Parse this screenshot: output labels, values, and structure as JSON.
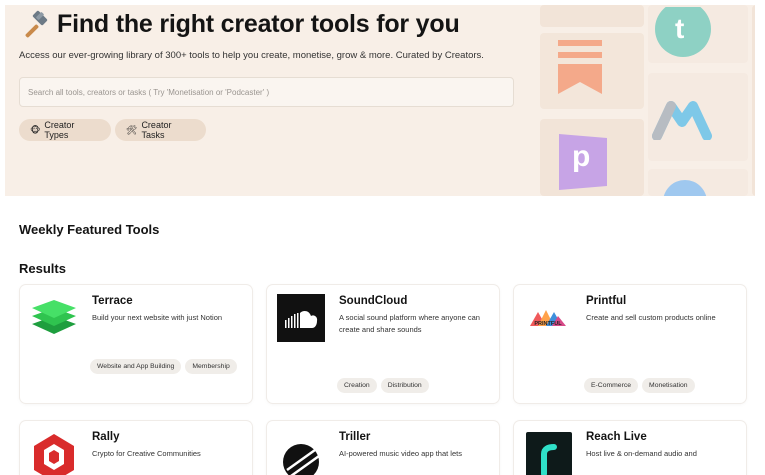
{
  "hero": {
    "title": "Find the right creator tools for you",
    "subtitle": "Access our ever-growing library of 300+ tools to help you create, monetise, grow & more. Curated by Creators.",
    "search_placeholder": "Search all tools, creators or tasks ( Try 'Monetisation or 'Podcaster' )",
    "chips": [
      {
        "emoji": "🐵",
        "label": "Creator Types"
      },
      {
        "emoji": "🛠",
        "label": "Creator Tasks"
      }
    ],
    "deco_letter_t": "t",
    "deco_letter_p": "p"
  },
  "sections": {
    "weekly": "Weekly Featured Tools",
    "results": "Results"
  },
  "cards": [
    {
      "name": "Terrace",
      "description": "Build your next website with just Notion",
      "tags": [
        "Website and App Building",
        "Membership"
      ],
      "logo": "stacked-layers-icon"
    },
    {
      "name": "SoundCloud",
      "description": "A social sound platform where anyone can create and share sounds",
      "tags": [
        "Creation",
        "Distribution"
      ],
      "logo": "soundcloud-icon"
    },
    {
      "name": "Printful",
      "description": "Create and sell custom products online",
      "tags": [
        "E-Commerce",
        "Monetisation"
      ],
      "logo": "printful-icon",
      "logo_text": "PRINTFUL"
    },
    {
      "name": "Rally",
      "description": "Crypto for Creative Communities",
      "tags": [],
      "logo": "rally-icon"
    },
    {
      "name": "Triller",
      "description": "AI-powered music video app that lets",
      "tags": [],
      "logo": "triller-icon"
    },
    {
      "name": "Reach Live",
      "description": "Host live & on-demand audio and",
      "tags": [],
      "logo": "reach-live-icon"
    }
  ],
  "colors": {
    "hero_bg": "#f8efe7",
    "chip_bg": "#ecdccd",
    "tag_bg": "#f0ede9",
    "teal": "#8ed1c4",
    "purple": "#c7a4e6",
    "salmon": "#f4a98a"
  }
}
